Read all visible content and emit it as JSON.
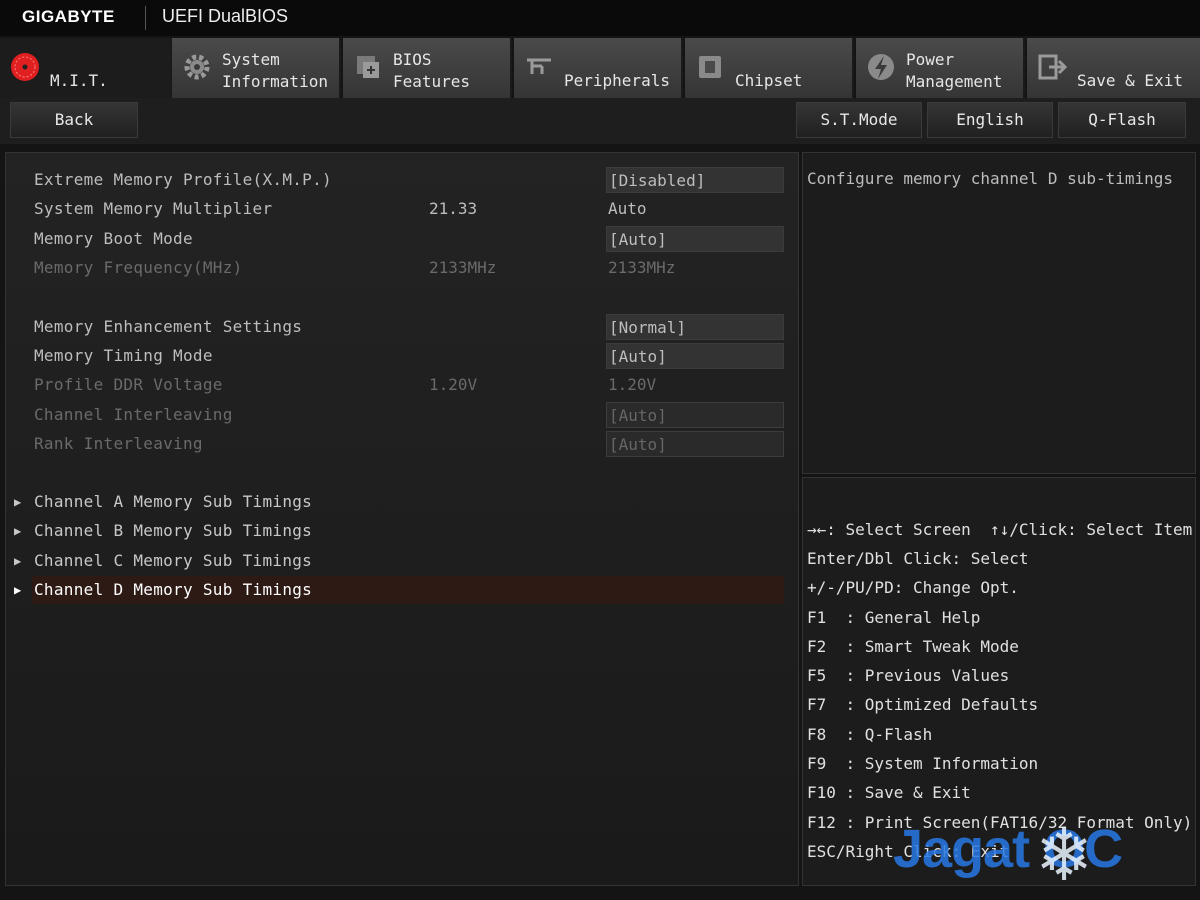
{
  "titlebar": {
    "brand": "GIGABYTE",
    "product": "UEFI DualBIOS"
  },
  "tabs": [
    {
      "label": "M.I.T.",
      "icon": "mit-gauge-icon",
      "active": true
    },
    {
      "label": "System\nInformation",
      "icon": "gear-icon"
    },
    {
      "label": "BIOS\nFeatures",
      "icon": "bios-chip-icon"
    },
    {
      "label": "Peripherals",
      "icon": "peripherals-icon"
    },
    {
      "label": "Chipset",
      "icon": "chipset-icon"
    },
    {
      "label": "Power\nManagement",
      "icon": "power-icon"
    },
    {
      "label": "Save & Exit",
      "icon": "exit-icon"
    }
  ],
  "toolbar": {
    "back": "Back",
    "st_mode": "S.T.Mode",
    "language": "English",
    "qflash": "Q-Flash"
  },
  "settings": [
    {
      "label": "Extreme Memory Profile(X.M.P.)",
      "current": "",
      "value": "[Disabled]",
      "boxed": true,
      "dim": false
    },
    {
      "label": "System Memory Multiplier",
      "current": "21.33",
      "value": "Auto",
      "boxed": false,
      "dim": false
    },
    {
      "label": "Memory Boot Mode",
      "current": "",
      "value": "[Auto]",
      "boxed": true,
      "dim": false
    },
    {
      "label": "Memory Frequency(MHz)",
      "current": "2133MHz",
      "value": "2133MHz",
      "boxed": false,
      "dim": true
    },
    {
      "label": "Memory Enhancement Settings",
      "current": "",
      "value": "[Normal]",
      "boxed": true,
      "dim": false
    },
    {
      "label": "Memory Timing Mode",
      "current": "",
      "value": "[Auto]",
      "boxed": true,
      "dim": false
    },
    {
      "label": "Profile DDR Voltage",
      "current": "1.20V",
      "value": "1.20V",
      "boxed": false,
      "dim": true
    },
    {
      "label": "Channel Interleaving",
      "current": "",
      "value": "[Auto]",
      "boxed": true,
      "dim": true
    },
    {
      "label": "Rank Interleaving",
      "current": "",
      "value": "[Auto]",
      "boxed": true,
      "dim": true
    }
  ],
  "submenus": [
    {
      "label": "Channel A Memory Sub Timings",
      "selected": false
    },
    {
      "label": "Channel B Memory Sub Timings",
      "selected": false
    },
    {
      "label": "Channel C Memory Sub Timings",
      "selected": false
    },
    {
      "label": "Channel D Memory Sub Timings",
      "selected": true
    }
  ],
  "help": {
    "text": "Configure memory channel D sub-timings"
  },
  "keys": [
    "→←: Select Screen  ↑↓/Click: Select Item",
    "Enter/Dbl Click: Select",
    "+/-/PU/PD: Change Opt.",
    "F1  : General Help",
    "F2  : Smart Tweak Mode",
    "F5  : Previous Values",
    "F7  : Optimized Defaults",
    "F8  : Q-Flash",
    "F9  : System Information",
    "F10 : Save & Exit",
    "F12 : Print Screen(FAT16/32 Format Only)",
    "ESC/Right Click: Exit"
  ],
  "watermark": {
    "text": "Jagat OC",
    "icon": "snowflake-icon"
  },
  "colors": {
    "selected_row": "#2e1a15",
    "mit_icon": "#e02020"
  }
}
